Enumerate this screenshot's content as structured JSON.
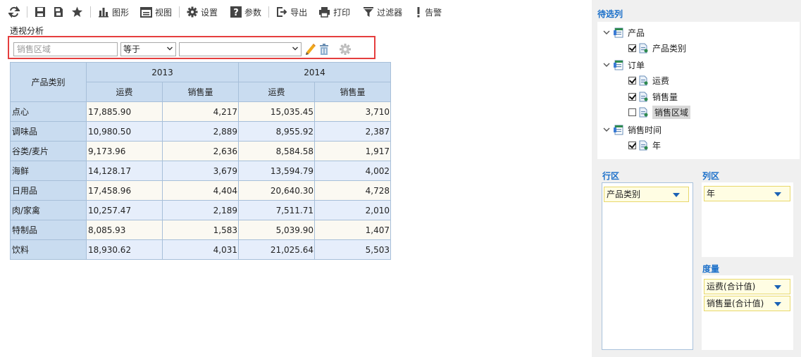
{
  "toolbar": {
    "items": [
      {
        "icon": "refresh-icon",
        "label": ""
      },
      {
        "icon": "save-icon",
        "label": ""
      },
      {
        "icon": "save-as-icon",
        "label": ""
      },
      {
        "icon": "star-icon",
        "label": ""
      },
      {
        "icon": "chart-icon",
        "label": "图形"
      },
      {
        "icon": "view-icon",
        "label": "视图"
      },
      {
        "icon": "gear-icon",
        "label": "设置"
      },
      {
        "icon": "help-icon",
        "label": "参数"
      },
      {
        "icon": "export-icon",
        "label": "导出"
      },
      {
        "icon": "print-icon",
        "label": "打印"
      },
      {
        "icon": "filter-icon",
        "label": "过滤器"
      },
      {
        "icon": "alert-icon",
        "label": "告警"
      }
    ]
  },
  "page": {
    "title": "透视分析"
  },
  "filter": {
    "field_placeholder": "销售区域",
    "operator": "等于",
    "value": ""
  },
  "pivot": {
    "row_header": "产品类别",
    "years": [
      "2013",
      "2014"
    ],
    "measures": [
      "运费",
      "销售量"
    ],
    "rows": [
      {
        "category": "点心",
        "v2013_freight": "17,885.90",
        "v2013_qty": "4,217",
        "v2014_freight": "15,035.45",
        "v2014_qty": "3,710"
      },
      {
        "category": "调味品",
        "v2013_freight": "10,980.50",
        "v2013_qty": "2,889",
        "v2014_freight": "8,955.92",
        "v2014_qty": "2,387"
      },
      {
        "category": "谷类/麦片",
        "v2013_freight": "9,173.96",
        "v2013_qty": "2,636",
        "v2014_freight": "8,584.58",
        "v2014_qty": "1,917"
      },
      {
        "category": "海鲜",
        "v2013_freight": "14,128.17",
        "v2013_qty": "3,679",
        "v2014_freight": "13,594.79",
        "v2014_qty": "4,002"
      },
      {
        "category": "日用品",
        "v2013_freight": "17,458.96",
        "v2013_qty": "4,404",
        "v2014_freight": "20,640.30",
        "v2014_qty": "4,728"
      },
      {
        "category": "肉/家禽",
        "v2013_freight": "10,257.47",
        "v2013_qty": "2,189",
        "v2014_freight": "7,511.71",
        "v2014_qty": "2,010"
      },
      {
        "category": "特制品",
        "v2013_freight": "8,085.93",
        "v2013_qty": "1,583",
        "v2014_freight": "5,039.90",
        "v2014_qty": "1,407"
      },
      {
        "category": "饮料",
        "v2013_freight": "18,930.62",
        "v2013_qty": "4,031",
        "v2014_freight": "21,025.64",
        "v2014_qty": "5,503"
      }
    ]
  },
  "panel": {
    "candidates_title": "待选列",
    "tree": [
      {
        "label": "产品",
        "type": "folder"
      },
      {
        "label": "产品类别",
        "type": "field",
        "checked": true
      },
      {
        "label": "订单",
        "type": "folder"
      },
      {
        "label": "运费",
        "type": "field",
        "checked": true
      },
      {
        "label": "销售量",
        "type": "field",
        "checked": true
      },
      {
        "label": "销售区域",
        "type": "field",
        "checked": false,
        "highlighted": true
      },
      {
        "label": "销售时间",
        "type": "folder"
      },
      {
        "label": "年",
        "type": "field",
        "checked": true
      }
    ],
    "rows_title": "行区",
    "cols_title": "列区",
    "measures_title": "度量",
    "row_chips": [
      "产品类别"
    ],
    "col_chips": [
      "年"
    ],
    "measure_chips": [
      "运费(合计值)",
      "销售量(合计值)"
    ]
  },
  "colors": {
    "accent": "#1a6fc9",
    "highlight_border": "#e53e3e",
    "header_bg": "#c9dcf0",
    "chip_bg": "#fffde3"
  }
}
